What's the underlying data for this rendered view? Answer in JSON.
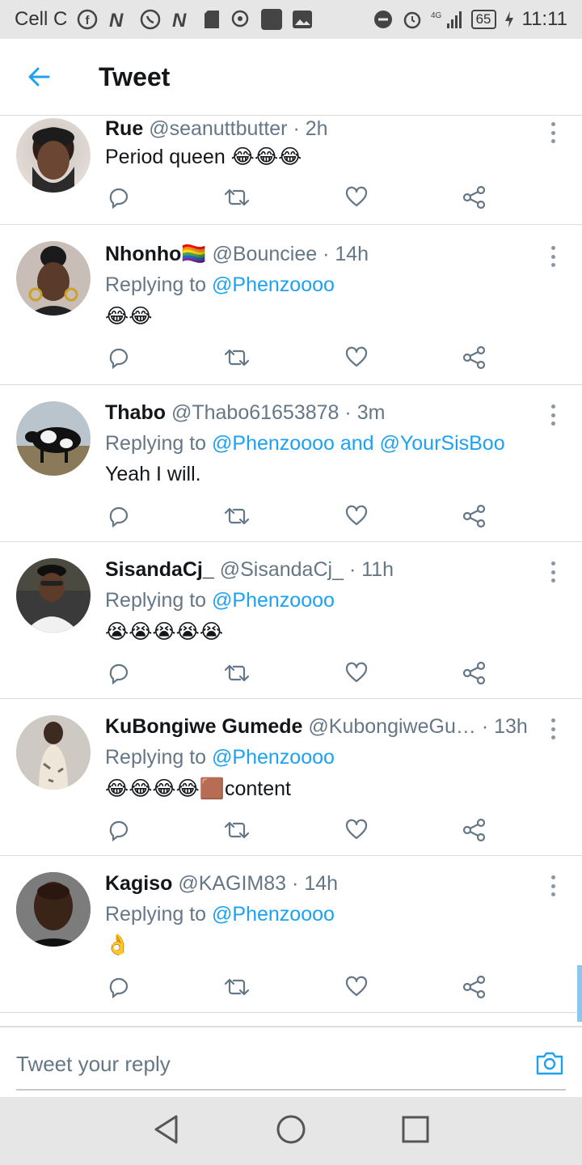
{
  "status_bar": {
    "carrier": "Cell C",
    "network": "4G",
    "battery": "65",
    "time": "11:11"
  },
  "header": {
    "title": "Tweet"
  },
  "tweets": [
    {
      "name": "Rue",
      "handle": "@seanuttbutter",
      "dot": "·",
      "time": "2h",
      "text": "Period queen 😂😂😂"
    },
    {
      "name": "Nhonho🏳️‍🌈",
      "handle": "@Bounciee",
      "dot": "·",
      "time": "14h",
      "reply_prefix": "Replying to",
      "reply_to": "@Phenzoooo",
      "text": "😂😂"
    },
    {
      "name": "Thabo",
      "handle": "@Thabo61653878",
      "dot": "·",
      "time": "3m",
      "reply_prefix": "Replying to",
      "reply_to": "@Phenzoooo and @YourSisBoo",
      "text": "Yeah I will."
    },
    {
      "name": "SisandaCj_",
      "handle": "@SisandaCj_",
      "dot": "·",
      "time": "11h",
      "reply_prefix": "Replying to",
      "reply_to": "@Phenzoooo",
      "text": "😭😭😭😭😭"
    },
    {
      "name": "KuBongiwe Gumede",
      "handle": "@KubongiweGu…",
      "dot": "·",
      "time": "13h",
      "reply_prefix": "Replying to",
      "reply_to": "@Phenzoooo",
      "text": "😂😂😂😂🟫content"
    },
    {
      "name": "Kagiso",
      "handle": "@KAGIM83",
      "dot": "·",
      "time": "14h",
      "reply_prefix": "Replying to",
      "reply_to": "@Phenzoooo",
      "text": "👌"
    }
  ],
  "composer": {
    "placeholder": "Tweet your reply"
  },
  "icons": {
    "back": "arrow-left-icon",
    "reply": "reply-icon",
    "retweet": "retweet-icon",
    "like": "heart-icon",
    "share": "share-icon",
    "more": "more-vertical-icon",
    "camera": "camera-icon"
  },
  "colors": {
    "accent": "#1da1f2",
    "text": "#14171a",
    "secondary": "#657786",
    "action_icon": "#657786"
  }
}
